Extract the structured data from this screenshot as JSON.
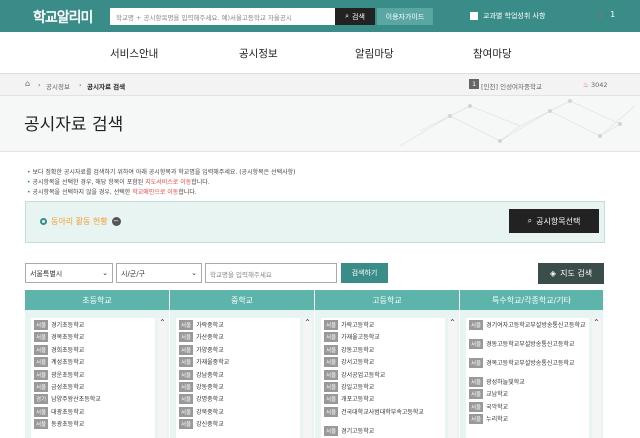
{
  "header": {
    "logo": "학교알리미",
    "search_placeholder": "학교명 + 공시항목명을 입력해주세요. 예)서울고등학교 자율공시",
    "search_btn": "검색",
    "guide_btn": "이용자가이드",
    "achievement": "교과별 학업성취 사항",
    "flame_count": "1"
  },
  "nav": [
    "서비스안내",
    "공시정보",
    "알림마당",
    "참여마당"
  ],
  "breadcrumb": {
    "items": [
      "공시정보",
      "공시자료 검색"
    ],
    "school": "[인천] 인성여자중학교",
    "tag": "1",
    "code": "3042"
  },
  "page_title": "공시자료 검색",
  "notes": {
    "n1": "보다 정확한 공시자료를 검색하기 위하여 아래 공시항목과 학교명을 입력해주세요. (공시항목은 선택사항)",
    "n2a": "공시항목을 선택한 경우, 해당 항목이 포함된",
    "n2r": "지도서비스로 이동",
    "n2b": "합니다.",
    "n3a": "공시항목을 선택하지 않을 경우, 선택한",
    "n3r": "학교메인으로 이동",
    "n3b": "합니다."
  },
  "filter": {
    "club": "동아리 활동 현황",
    "select_btn": "공시항목선택"
  },
  "controls": {
    "region": "서울특별시",
    "district": "시/군/구",
    "school_placeholder": "학교명을 입력해주세요",
    "search": "검색하기",
    "map": "지도 검색"
  },
  "columns": [
    {
      "title": "초등학교",
      "items": [
        {
          "t": "서울",
          "n": "경기초등학교"
        },
        {
          "t": "서울",
          "n": "경복초등학교"
        },
        {
          "t": "서울",
          "n": "경희초등학교"
        },
        {
          "t": "서울",
          "n": "계성초등학교"
        },
        {
          "t": "서울",
          "n": "광운초등학교"
        },
        {
          "t": "서울",
          "n": "금성초등학교"
        },
        {
          "t": "경기",
          "n": "남양주왕산초등학교"
        },
        {
          "t": "서울",
          "n": "대광초등학교"
        },
        {
          "t": "서울",
          "n": "동광초등학교"
        }
      ]
    },
    {
      "title": "중학교",
      "items": [
        {
          "t": "서울",
          "n": "가락중학교"
        },
        {
          "t": "서울",
          "n": "가산중학교"
        },
        {
          "t": "서울",
          "n": "가양중학교"
        },
        {
          "t": "서울",
          "n": "가재울중학교"
        },
        {
          "t": "서울",
          "n": "강남중학교"
        },
        {
          "t": "서울",
          "n": "강동중학교"
        },
        {
          "t": "서울",
          "n": "강명중학교"
        },
        {
          "t": "서울",
          "n": "강북중학교"
        },
        {
          "t": "서울",
          "n": "강신중학교"
        }
      ]
    },
    {
      "title": "고등학교",
      "items": [
        {
          "t": "서울",
          "n": "가락고등학교"
        },
        {
          "t": "서울",
          "n": "가재울고등학교"
        },
        {
          "t": "서울",
          "n": "강동고등학교"
        },
        {
          "t": "서울",
          "n": "강서고등학교"
        },
        {
          "t": "서울",
          "n": "강서공업고등학교"
        },
        {
          "t": "서울",
          "n": "강일고등학교"
        },
        {
          "t": "서울",
          "n": "개포고등학교"
        },
        {
          "t": "서울",
          "n": "건국대학교사범대학부속고등학교"
        },
        {
          "t": "서울",
          "n": "경기고등학교"
        }
      ]
    },
    {
      "title": "특수학교/각종학교/기타",
      "items": [
        {
          "t": "서울",
          "n": "경기여자고등학교부설방송통신고등학교"
        },
        {
          "t": "서울",
          "n": "경동고등학교부설방송통신고등학교"
        },
        {
          "t": "서울",
          "n": "경복고등학교부설방송통신고등학교"
        },
        {
          "t": "서울",
          "n": "광성하늘빛학교"
        },
        {
          "t": "서울",
          "n": "교남학교"
        },
        {
          "t": "서울",
          "n": "국악학교"
        },
        {
          "t": "서울",
          "n": "누리학교"
        }
      ]
    }
  ]
}
